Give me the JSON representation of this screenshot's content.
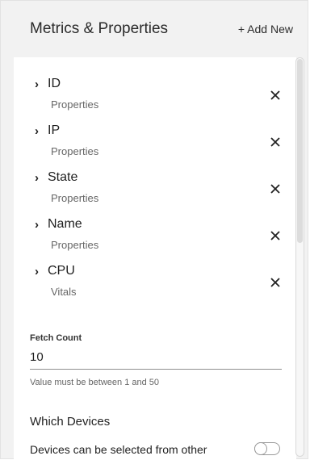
{
  "header": {
    "title": "Metrics & Properties",
    "add_label": "+ Add New"
  },
  "metrics": [
    {
      "name": "ID",
      "type": "Properties"
    },
    {
      "name": "IP",
      "type": "Properties"
    },
    {
      "name": "State",
      "type": "Properties"
    },
    {
      "name": "Name",
      "type": "Properties"
    },
    {
      "name": "CPU",
      "type": "Vitals"
    }
  ],
  "icons": {
    "expand": "chevron-right-icon",
    "remove": "close-icon"
  },
  "fetch": {
    "label": "Fetch Count",
    "value": "10",
    "help": "Value must be between 1 and 50"
  },
  "devices": {
    "heading": "Which Devices",
    "text": "Devices can be selected from other",
    "toggle_on": false
  }
}
